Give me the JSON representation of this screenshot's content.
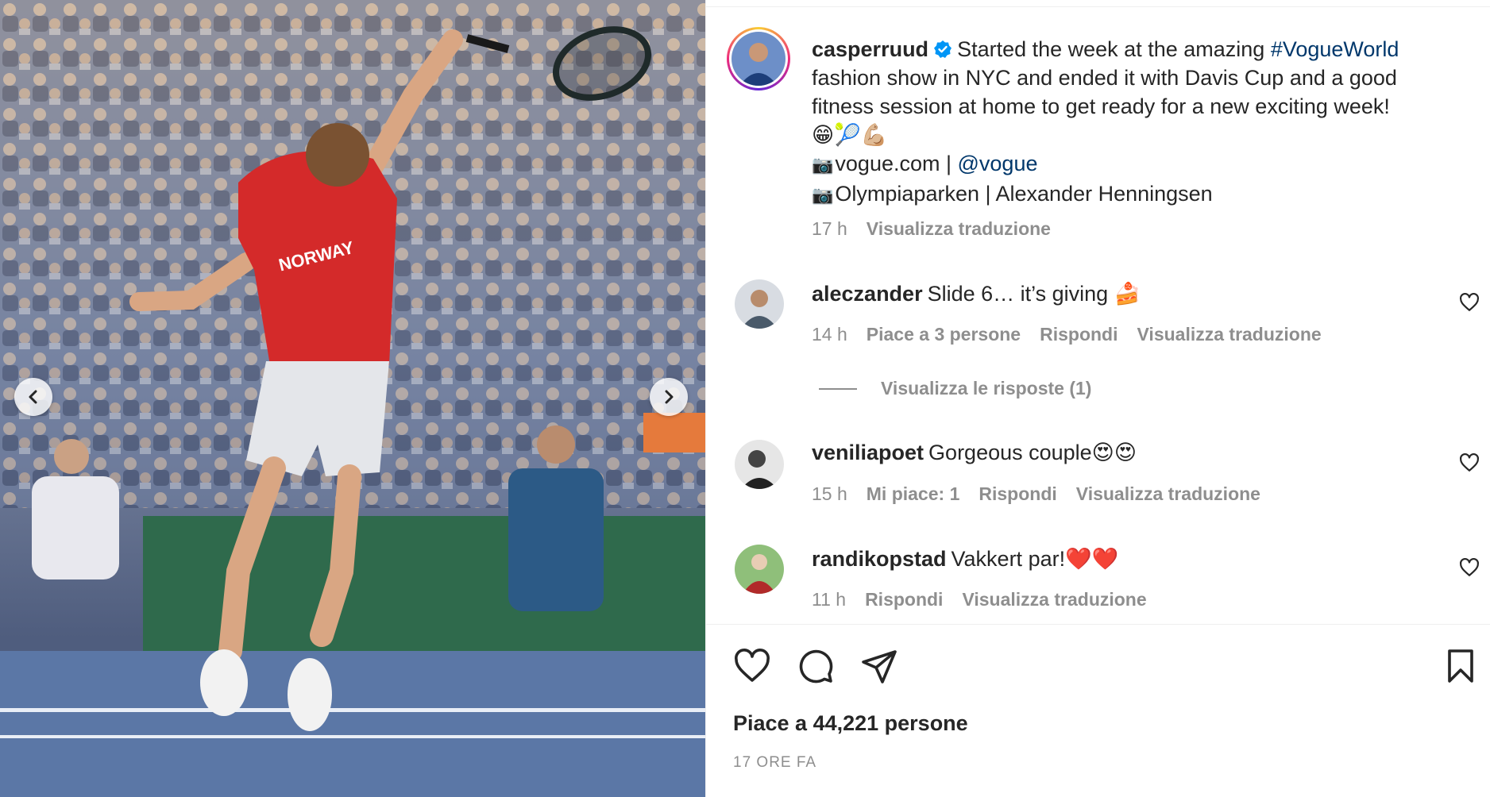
{
  "media": {
    "shirt_text": "NORWAY",
    "prev_icon": "chevron-left-icon",
    "next_icon": "chevron-right-icon"
  },
  "post": {
    "author": "casperruud",
    "caption_l1": "Started the week at the amazing",
    "hashtag": "#VogueWorld",
    "caption_l2": "fashion show in NYC and ended it with Davis Cup and a good",
    "caption_l3": "fitness session at home to get ready for a new exciting week!",
    "emojis": "😁🎾💪🏼",
    "credit1_text": "vogue.com | ",
    "credit1_mention": "@vogue",
    "credit2_text": "Olympiaparken | Alexander Henningsen",
    "camera_glyph": "📷",
    "time": "17 h",
    "translate": "Visualizza traduzione"
  },
  "comments": [
    {
      "user": "aleczander",
      "text": "Slide 6… it’s giving 🍰",
      "time": "14 h",
      "likes": "Piace a 3 persone",
      "reply": "Rispondi",
      "translate": "Visualizza traduzione"
    },
    {
      "user": "veniliapoet",
      "text": "Gorgeous couple😍😍",
      "time": "15 h",
      "likes": "Mi piace: 1",
      "reply": "Rispondi",
      "translate": "Visualizza traduzione"
    },
    {
      "user": "randikopstad",
      "text": "Vakkert par!❤️❤️",
      "time": "11 h",
      "reply": "Rispondi",
      "translate": "Visualizza traduzione"
    }
  ],
  "view_replies": "Visualizza le risposte (1)",
  "actions": {
    "like_icon": "heart-icon",
    "comment_icon": "comment-icon",
    "share_icon": "send-icon",
    "save_icon": "bookmark-icon"
  },
  "likes_summary": "Piace a 44,221 persone",
  "posted_ago": "17 ORE FA",
  "colors": {
    "link": "#00376b",
    "muted": "#8e8e8e",
    "verified": "#0095f6",
    "shirt": "#d42a2a"
  }
}
